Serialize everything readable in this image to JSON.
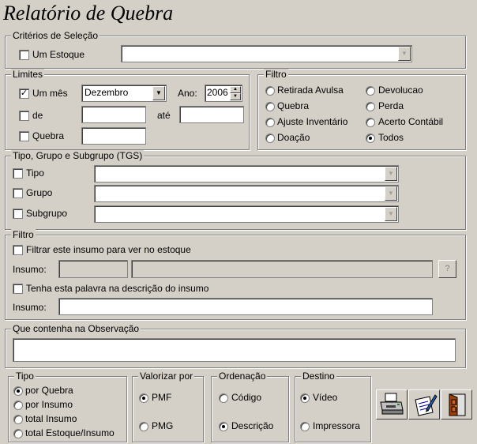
{
  "window": {
    "title": "Relatório de Quebra"
  },
  "criterios": {
    "legend": "Critérios de Seleção",
    "um_estoque": {
      "label": "Um Estoque",
      "checked": false
    },
    "estoque_value": ""
  },
  "limites": {
    "legend": "Limites",
    "um_mes": {
      "label": "Um mês",
      "checked": true
    },
    "mes_value": "Dezembro",
    "ano_label": "Ano:",
    "ano_value": "2006",
    "de": {
      "label": "de",
      "checked": false,
      "value": ""
    },
    "ate_label": "até",
    "ate_value": "",
    "quebra": {
      "label": "Quebra",
      "checked": false,
      "value": ""
    }
  },
  "filtro_tipo": {
    "legend": "Filtro",
    "options": [
      {
        "label": "Retirada Avulsa",
        "selected": false
      },
      {
        "label": "Devolucao",
        "selected": false
      },
      {
        "label": "Quebra",
        "selected": false
      },
      {
        "label": "Perda",
        "selected": false
      },
      {
        "label": "Ajuste Inventário",
        "selected": false
      },
      {
        "label": "Acerto Contábil",
        "selected": false
      },
      {
        "label": "Doação",
        "selected": false
      },
      {
        "label": "Todos",
        "selected": true
      }
    ]
  },
  "tgs": {
    "legend": "Tipo, Grupo e Subgrupo (TGS)",
    "tipo": {
      "label": "Tipo",
      "checked": false,
      "value": ""
    },
    "grupo": {
      "label": "Grupo",
      "checked": false,
      "value": ""
    },
    "subgrupo": {
      "label": "Subgrupo",
      "checked": false,
      "value": ""
    }
  },
  "filtro_insumo": {
    "legend": "Filtro",
    "filtrar": {
      "label": "Filtrar este insumo para ver no estoque",
      "checked": false
    },
    "insumo_label": "Insumo:",
    "insumo_code": "",
    "insumo_desc": "",
    "lookup_label": "?",
    "palavra": {
      "label": "Tenha esta palavra na descrição do insumo",
      "checked": false
    },
    "insumo2_label": "Insumo:",
    "insumo2_value": ""
  },
  "observacao": {
    "legend": "Que contenha na Observação",
    "value": ""
  },
  "tipo": {
    "legend": "Tipo",
    "options": [
      {
        "label": "por Quebra",
        "selected": true
      },
      {
        "label": "por Insumo",
        "selected": false
      },
      {
        "label": "total Insumo",
        "selected": false
      },
      {
        "label": "total Estoque/Insumo",
        "selected": false
      }
    ]
  },
  "valorizar": {
    "legend": "Valorizar por",
    "options": [
      {
        "label": "PMF",
        "selected": true
      },
      {
        "label": "PMG",
        "selected": false
      }
    ]
  },
  "ordenacao": {
    "legend": "Ordenação",
    "options": [
      {
        "label": "Código",
        "selected": false
      },
      {
        "label": "Descrição",
        "selected": true
      }
    ]
  },
  "destino": {
    "legend": "Destino",
    "options": [
      {
        "label": "Vídeo",
        "selected": true
      },
      {
        "label": "Impressora",
        "selected": false
      }
    ]
  },
  "toolbar": {
    "icons": [
      "printer-icon",
      "edit-report-icon",
      "exit-door-icon"
    ]
  }
}
